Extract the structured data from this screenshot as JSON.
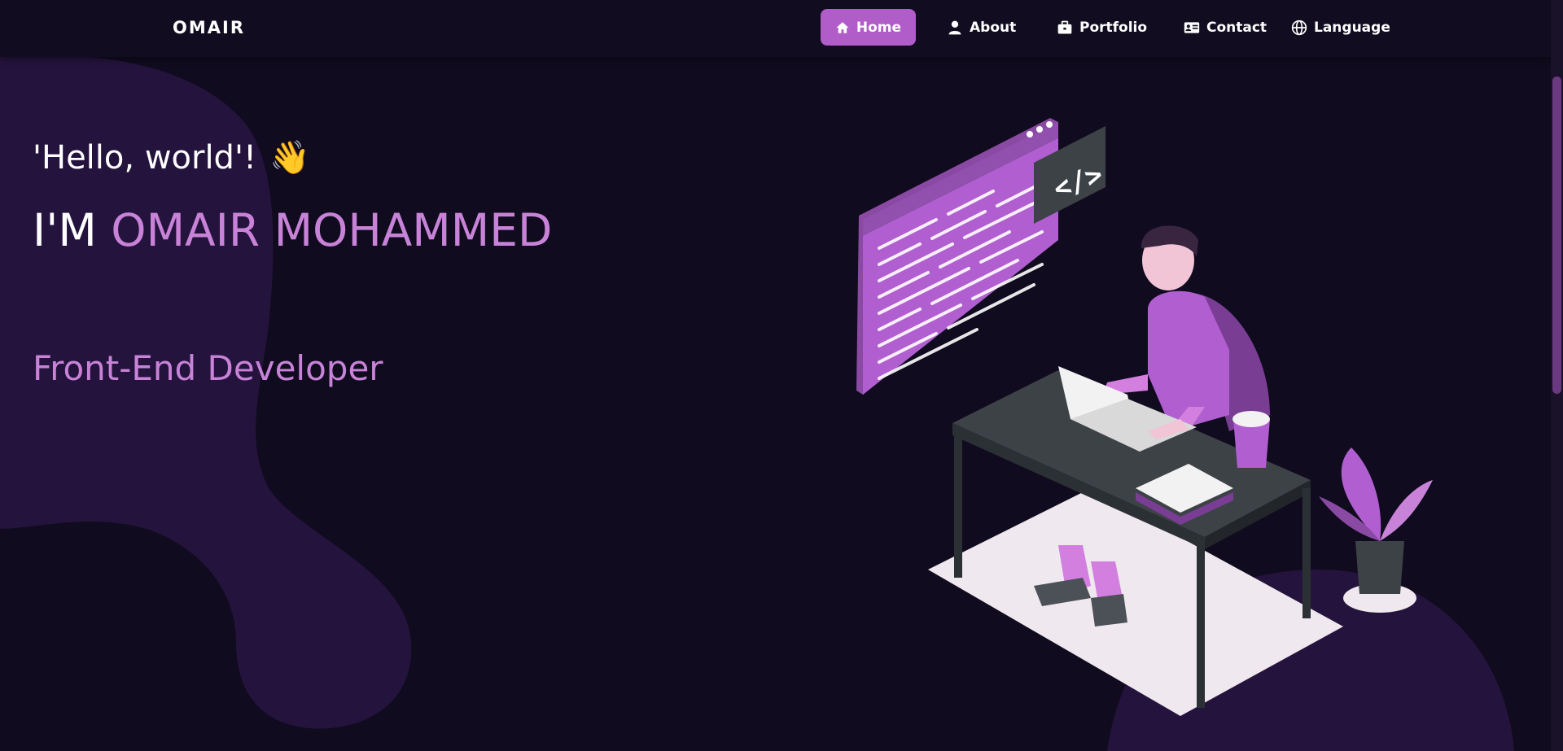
{
  "brand": "OMAIR",
  "nav": {
    "items": [
      {
        "label": "Home",
        "icon": "home-icon",
        "active": true
      },
      {
        "label": "About",
        "icon": "user-icon",
        "active": false
      },
      {
        "label": "Portfolio",
        "icon": "briefcase-icon",
        "active": false
      },
      {
        "label": "Contact",
        "icon": "id-card-icon",
        "active": false
      },
      {
        "label": "Language",
        "icon": "globe-icon",
        "active": false
      }
    ]
  },
  "hero": {
    "greeting": "'Hello, world'!",
    "wave_emoji": "👋",
    "name_prefix": "I'M",
    "name": "OMAIR MOHAMMED",
    "role": "Front-End Developer"
  },
  "illustration": {
    "code_badge": "</>",
    "icon": "developer-at-desk-illustration"
  },
  "colors": {
    "background": "#100b1e",
    "accent": "#b05cc9",
    "accent_text": "#c883d8",
    "blob": "#2b1745"
  }
}
